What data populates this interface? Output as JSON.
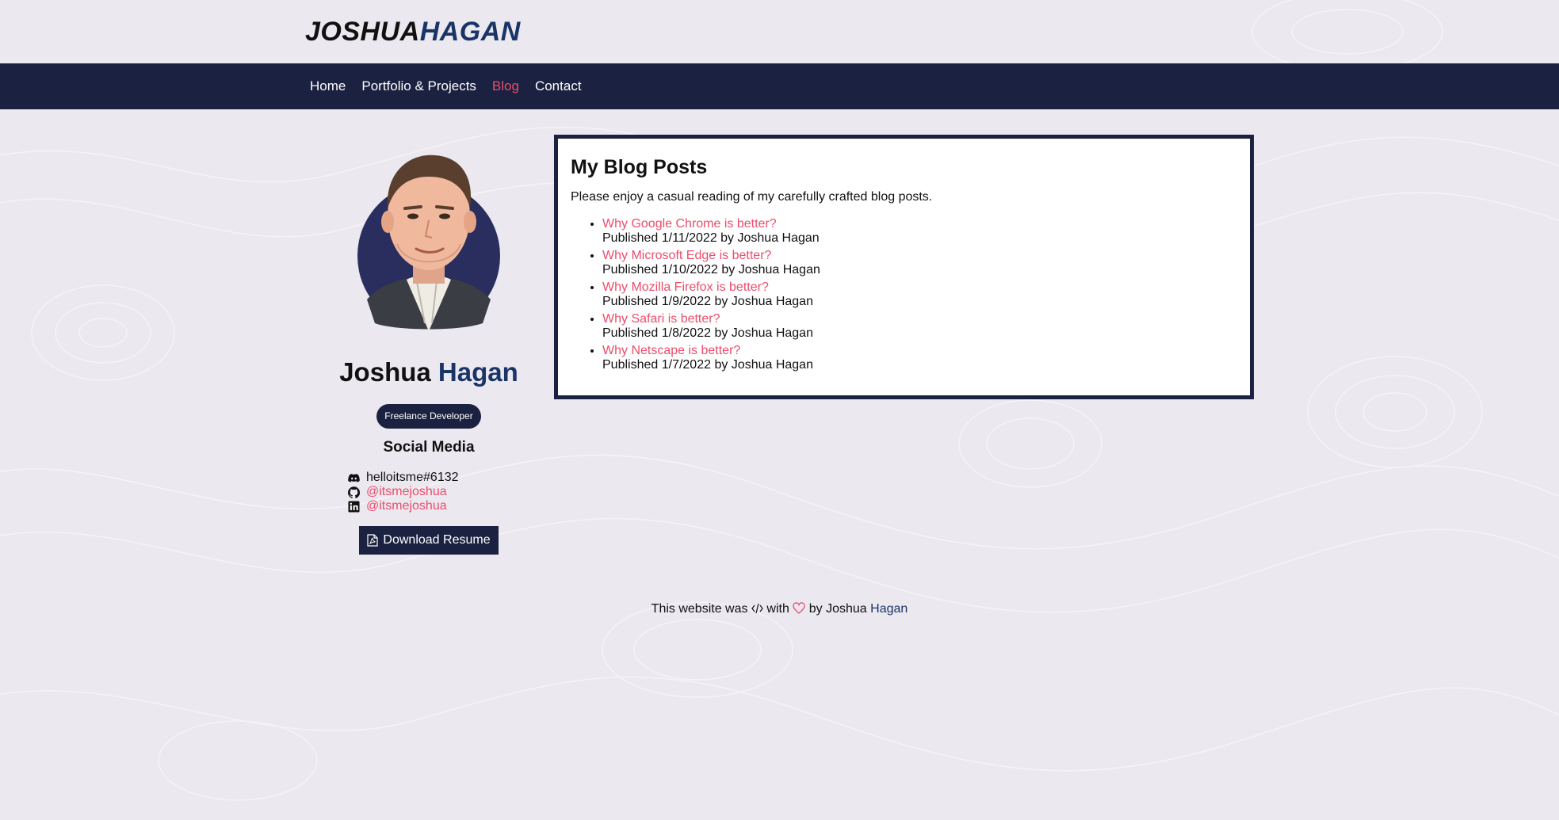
{
  "header": {
    "logo_first": "JOSHUA",
    "logo_last": "HAGAN"
  },
  "nav": {
    "items": [
      {
        "label": "Home",
        "active": false
      },
      {
        "label": "Portfolio & Projects",
        "active": false
      },
      {
        "label": "Blog",
        "active": true
      },
      {
        "label": "Contact",
        "active": false
      }
    ]
  },
  "profile": {
    "first_name": "Joshua",
    "last_name": "Hagan",
    "role": "Freelance Developer",
    "social_heading": "Social Media",
    "social": [
      {
        "icon": "discord-icon",
        "text": "helloitsme#6132"
      },
      {
        "icon": "github-icon",
        "text": "@itsmejoshua"
      },
      {
        "icon": "linkedin-icon",
        "text": "@itsmejoshua"
      }
    ],
    "resume_label": "Download Resume"
  },
  "blog": {
    "title": "My Blog Posts",
    "intro": "Please enjoy a casual reading of my carefully crafted blog posts.",
    "posts": [
      {
        "title": "Why Google Chrome is better?",
        "meta": "Published 1/11/2022 by Joshua Hagan"
      },
      {
        "title": "Why Microsoft Edge is better?",
        "meta": "Published 1/10/2022 by Joshua Hagan"
      },
      {
        "title": "Why Mozilla Firefox is better?",
        "meta": "Published 1/9/2022 by Joshua Hagan"
      },
      {
        "title": "Why Safari is better?",
        "meta": "Published 1/8/2022 by Joshua Hagan"
      },
      {
        "title": "Why Netscape is better?",
        "meta": "Published 1/7/2022 by Joshua Hagan"
      }
    ]
  },
  "footer": {
    "prefix": "This website was",
    "with": "with",
    "by": "by Joshua",
    "last": "Hagan"
  },
  "colors": {
    "navy": "#1b2140",
    "accent": "#ee4c6b",
    "brand_blue": "#1a3467",
    "background": "#ebe8ef"
  }
}
